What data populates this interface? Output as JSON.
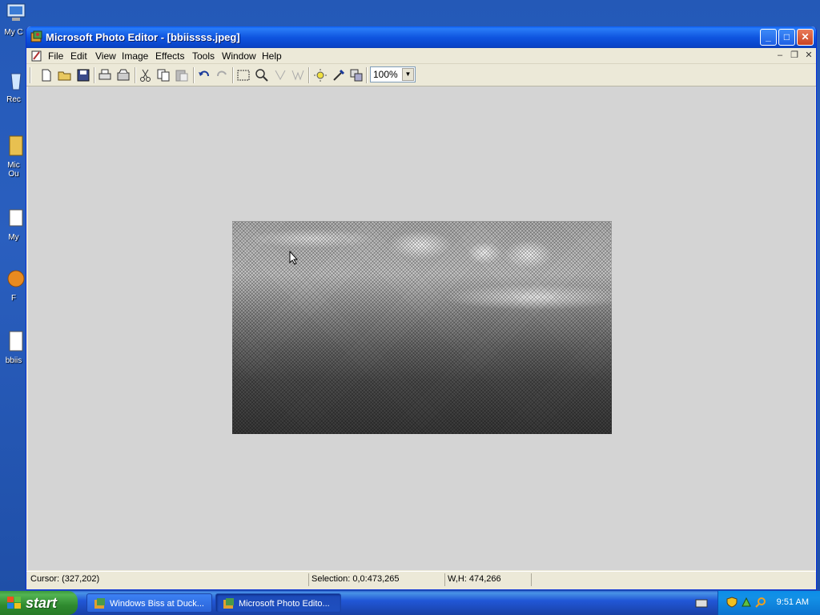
{
  "desktop": {
    "icons": [
      {
        "label": "My C"
      },
      {
        "label": "Rec"
      },
      {
        "label": "Mic\nOu"
      },
      {
        "label": "My"
      },
      {
        "label": "F"
      },
      {
        "label": "bbiis"
      }
    ]
  },
  "window": {
    "title": "Microsoft Photo Editor - [bbiissss.jpeg]",
    "controls": {
      "minimize": "_",
      "maximize": "□",
      "close": "✕"
    }
  },
  "menu": {
    "items": [
      "File",
      "Edit",
      "View",
      "Image",
      "Effects",
      "Tools",
      "Window",
      "Help"
    ],
    "mdi": {
      "minimize": "–",
      "restore": "❐",
      "close": "✕"
    }
  },
  "toolbar": {
    "tools": [
      "new-icon",
      "open-icon",
      "save-icon",
      "print-icon",
      "scan-icon",
      "cut-icon",
      "copy-icon",
      "paste-icon",
      "undo-icon",
      "redo-icon",
      "select-icon",
      "zoom-icon",
      "smudge-icon",
      "sharpen-icon",
      "brightness-icon",
      "eyedropper-icon",
      "properties-icon"
    ],
    "zoom_value": "100%"
  },
  "statusbar": {
    "cursor": "Cursor: (327,202)",
    "selection": "Selection: 0,0:473,265",
    "size": "W,H: 474,266"
  },
  "taskbar": {
    "start_label": "start",
    "tasks": [
      {
        "label": "Windows Biss at Duck...",
        "active": false
      },
      {
        "label": "Microsoft Photo Edito...",
        "active": true
      }
    ],
    "clock": "9:51 AM"
  },
  "colors": {
    "titlebar": "#0a5ef5",
    "workspace": "#d4d4d4",
    "start": "#3c9a3c",
    "tray": "#0c8ee8"
  }
}
